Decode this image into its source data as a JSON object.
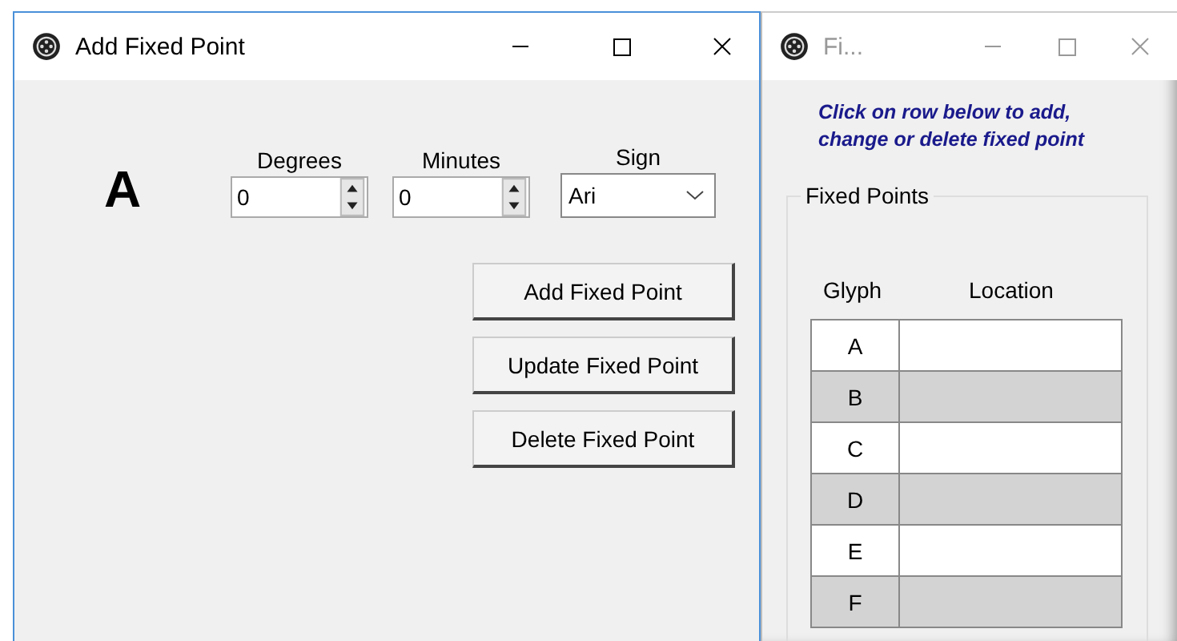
{
  "windows": [
    {
      "title": "Add Fixed Point",
      "active": true,
      "glyph": "A",
      "fields": [
        {
          "kind": "spin",
          "label": "Degrees",
          "value": "0"
        },
        {
          "kind": "spin",
          "label": "Minutes",
          "value": "0"
        },
        {
          "kind": "select",
          "label": "Sign",
          "value": "Ari"
        }
      ],
      "buttons": [
        "Add Fixed Point",
        "Update Fixed Point",
        "Delete Fixed Point"
      ]
    },
    {
      "title": "Fi...",
      "active": false,
      "instruction_lines": [
        "Click on row below to add,",
        "change or delete fixed point"
      ],
      "group": "Fixed Points",
      "columns": [
        "Glyph",
        "Location"
      ],
      "rows": [
        {
          "glyph": "A",
          "location": ""
        },
        {
          "glyph": "B",
          "location": ""
        },
        {
          "glyph": "C",
          "location": ""
        },
        {
          "glyph": "D",
          "location": ""
        },
        {
          "glyph": "E",
          "location": ""
        },
        {
          "glyph": "F",
          "location": ""
        }
      ]
    }
  ]
}
